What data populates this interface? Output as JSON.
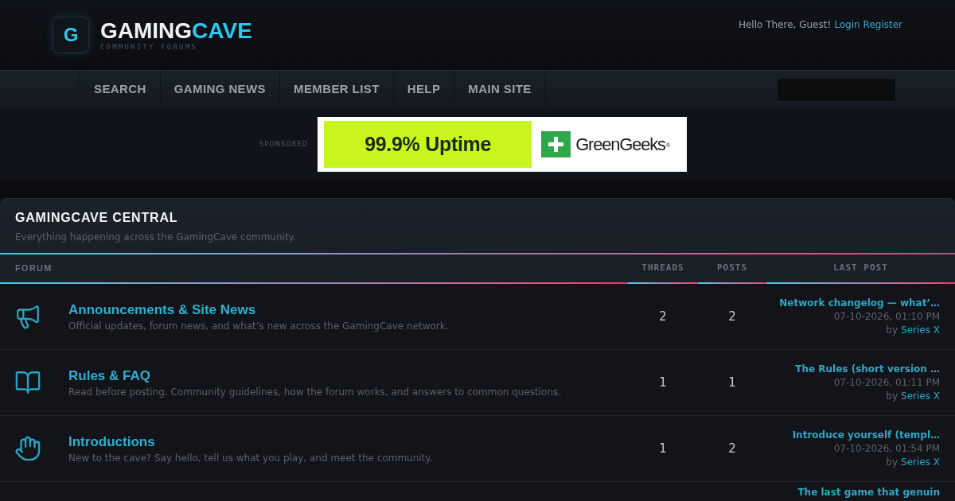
{
  "header": {
    "logo": {
      "letter": "G",
      "title_main": "GAMING",
      "title_accent": "CAVE",
      "tagline": "COMMUNITY FORUMS"
    },
    "welcome": {
      "greeting": "Hello There, Guest!",
      "links": [
        "Login",
        "Register"
      ]
    }
  },
  "nav": {
    "items": [
      "SEARCH",
      "GAMING NEWS",
      "MEMBER LIST",
      "HELP",
      "MAIN SITE"
    ]
  },
  "ad": {
    "label": "SPONSORED",
    "headline": "99.9% Uptime",
    "brand": "GreenGeeks$^{®}$"
  },
  "category": {
    "title": "GAMINGCAVE CENTRAL",
    "description": "Everything happening across the GamingCave community.",
    "columns": [
      "FORUM",
      "THREADS",
      "POSTS",
      "LAST POST"
    ],
    "forums": [
      {
        "name": "Announcements & Site News",
        "description": "Official updates, forum news, and what’s new across the GamingCave network.",
        "threads": "2",
        "posts": "2",
        "last_post": {
          "title": "Network changelog — what’…",
          "date": "07-10-2026, 01:10 PM",
          "by_label": "by",
          "author": "Series X"
        }
      },
      {
        "name": "Rules & FAQ",
        "description": "Read before posting. Community guidelines, how the forum works, and answers to common questions.",
        "threads": "1",
        "posts": "1",
        "last_post": {
          "title": "The Rules (short version …",
          "date": "07-10-2026, 01:11 PM",
          "by_label": "by",
          "author": "Series X"
        }
      },
      {
        "name": "Introductions",
        "description": "New to the cave? Say hello, tell us what you play, and meet the community.",
        "threads": "1",
        "posts": "2",
        "last_post": {
          "title": "Introduce yourself (templ…",
          "date": "07-10-2026, 01:54 PM",
          "by_label": "by",
          "author": "Series X"
        }
      },
      {
        "last_post": {
          "title": "The last game that genuin"
        }
      }
    ]
  }
}
